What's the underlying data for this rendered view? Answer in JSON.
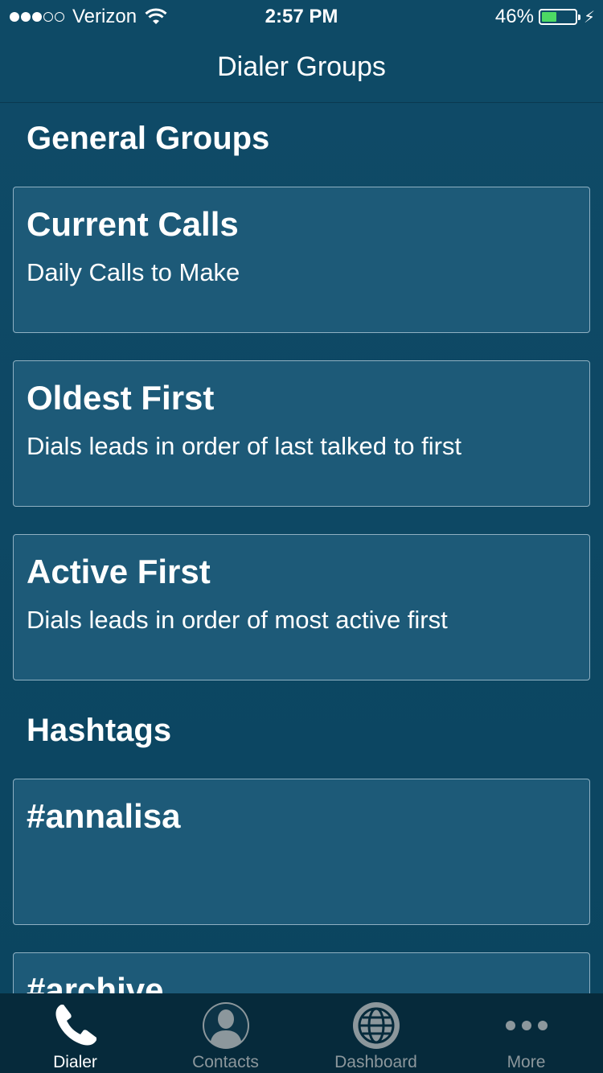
{
  "status": {
    "carrier": "Verizon",
    "time": "2:57 PM",
    "battery": "46%",
    "battery_level": 0.46,
    "signal_bars_filled": 3,
    "signal_bars_total": 5
  },
  "nav": {
    "title": "Dialer Groups"
  },
  "sections": {
    "general": "General Groups",
    "hashtags": "Hashtags"
  },
  "general_groups": [
    {
      "title": "Current Calls",
      "desc": "Daily Calls to Make"
    },
    {
      "title": "Oldest First",
      "desc": "Dials leads in order of last talked to first"
    },
    {
      "title": "Active First",
      "desc": "Dials leads in order of most active first"
    }
  ],
  "hashtag_groups": [
    {
      "title": "#annalisa",
      "desc": ""
    },
    {
      "title": "#archive",
      "desc": ""
    }
  ],
  "tabs": [
    {
      "label": "Dialer",
      "icon": "phone-icon",
      "active": true
    },
    {
      "label": "Contacts",
      "icon": "contact-icon",
      "active": false
    },
    {
      "label": "Dashboard",
      "icon": "globe-icon",
      "active": false
    },
    {
      "label": "More",
      "icon": "more-icon",
      "active": false
    }
  ],
  "colors": {
    "background": "#0e4a66",
    "card": "#1d5a78",
    "card_border": "#8fb0c2",
    "tab_bar": "#062a3b",
    "battery_fill": "#4cd964"
  }
}
